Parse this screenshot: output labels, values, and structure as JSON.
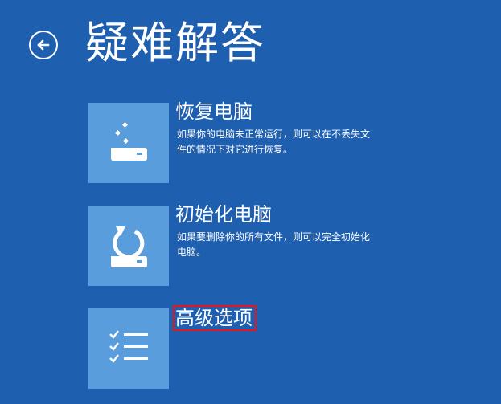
{
  "page": {
    "title": "疑难解答",
    "back_icon": "back-arrow-icon"
  },
  "options": [
    {
      "id": "recover",
      "icon": "recover-pc-icon",
      "title": "恢复电脑",
      "desc": "如果你的电脑未正常运行，则可以在不丢失文件的情况下对它进行恢复。"
    },
    {
      "id": "reset",
      "icon": "reset-pc-icon",
      "title": "初始化电脑",
      "desc": "如果要删除你的所有文件，则可以完全初始化电脑。"
    },
    {
      "id": "advanced",
      "icon": "checklist-icon",
      "title": "高级选项",
      "highlighted": true,
      "highlight_color": "#e8141c"
    }
  ],
  "colors": {
    "background": "#1e5fb0",
    "tile": "#5a9ddd",
    "text": "#ffffff"
  }
}
